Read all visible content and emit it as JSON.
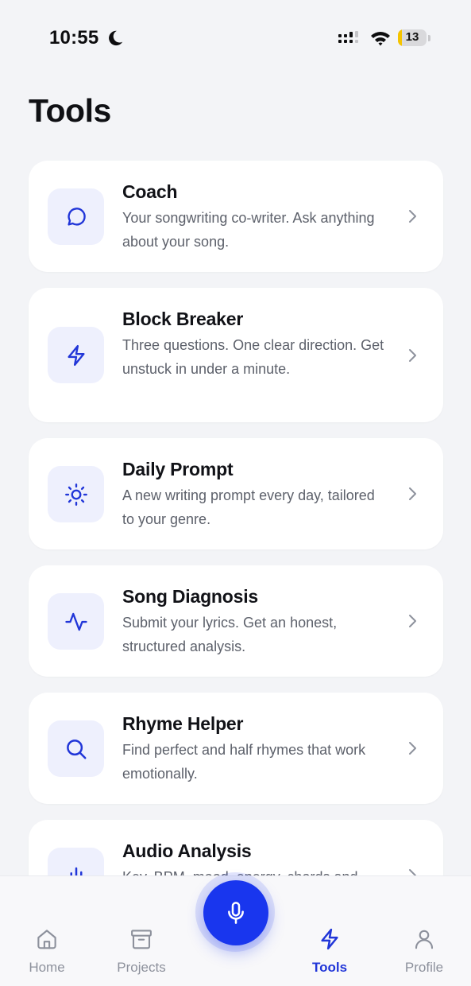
{
  "status_bar": {
    "time": "10:55",
    "battery_level": "13",
    "battery_fraction": 0.13,
    "icons": [
      "moon-icon",
      "signal-icon",
      "wifi-icon",
      "battery-icon"
    ]
  },
  "page": {
    "title": "Tools"
  },
  "tools": [
    {
      "title": "Coach",
      "description": "Your songwriting co-writer. Ask anything about your song.",
      "icon": "chat-bubble-icon"
    },
    {
      "title": "Block Breaker",
      "description": "Three questions. One clear direction. Get unstuck in under a minute.",
      "icon": "lightning-icon"
    },
    {
      "title": "Daily Prompt",
      "description": "A new writing prompt every day, tailored to your genre.",
      "icon": "sun-icon"
    },
    {
      "title": "Song Diagnosis",
      "description": "Submit your lyrics. Get an honest, structured analysis.",
      "icon": "pulse-icon"
    },
    {
      "title": "Rhyme Helper",
      "description": "Find perfect and half rhymes that work emotionally.",
      "icon": "search-icon"
    },
    {
      "title": "Audio Analysis",
      "description": "Key, BPM, mood, energy, chords and",
      "icon": "audio-icon"
    }
  ],
  "tab_bar": {
    "tabs": [
      {
        "label": "Home",
        "icon": "home-icon",
        "active": false
      },
      {
        "label": "Projects",
        "icon": "archive-icon",
        "active": false
      },
      {
        "label": "Tools",
        "icon": "lightning-icon",
        "active": true
      },
      {
        "label": "Profile",
        "icon": "user-icon",
        "active": false
      }
    ],
    "center_action_icon": "microphone-icon"
  },
  "colors": {
    "accent": "#1936EE",
    "active_tab": "#2136D8",
    "inactive_tab": "#8D919C",
    "icon_tile": "#EEF0FD",
    "background": "#F3F4F7",
    "battery_fill": "#F5C400"
  }
}
